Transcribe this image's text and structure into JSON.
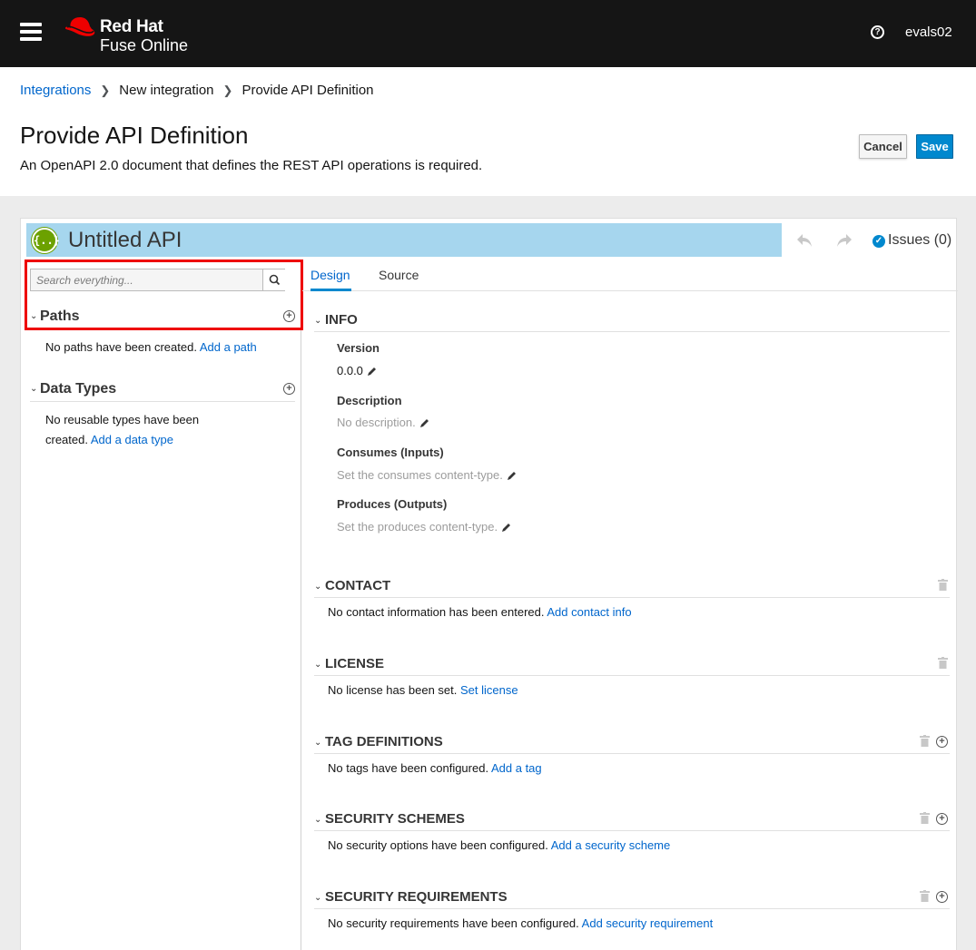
{
  "topbar": {
    "brand_line1": "Red Hat",
    "brand_line2": "Fuse Online",
    "help_glyph": "?",
    "username": "evals02"
  },
  "breadcrumb": {
    "items": [
      "Integrations",
      "New integration",
      "Provide API Definition"
    ]
  },
  "header": {
    "title": "Provide API Definition",
    "subtitle": "An OpenAPI 2.0 document that defines the REST API operations is required.",
    "cancel_label": "Cancel",
    "save_label": "Save"
  },
  "editor": {
    "logo_glyph": "{..}",
    "api_title": "Untitled API",
    "issues_label": "Issues (0)"
  },
  "left": {
    "search_placeholder": "Search everything...",
    "paths": {
      "label": "Paths",
      "empty_text": "No paths have been created.",
      "link": "Add a path"
    },
    "data_types": {
      "label": "Data Types",
      "empty_text_line1": "No reusable types have been",
      "empty_text_line2": "created.",
      "link": "Add a data type"
    }
  },
  "tabs": [
    "Design",
    "Source"
  ],
  "info": {
    "title": "INFO",
    "version_label": "Version",
    "version_value": "0.0.0",
    "description_label": "Description",
    "description_value": "No description.",
    "consumes_label": "Consumes (Inputs)",
    "consumes_value": "Set the consumes content-type.",
    "produces_label": "Produces (Outputs)",
    "produces_value": "Set the produces content-type."
  },
  "sections": {
    "contact": {
      "title": "CONTACT",
      "text": "No contact information has been entered.",
      "link": "Add contact info"
    },
    "license": {
      "title": "LICENSE",
      "text": "No license has been set.",
      "link": "Set license"
    },
    "tags": {
      "title": "TAG DEFINITIONS",
      "text": "No tags have been configured.",
      "link": "Add a tag"
    },
    "security_schemes": {
      "title": "SECURITY SCHEMES",
      "text": "No security options have been configured.",
      "link": "Add a security scheme"
    },
    "security_requirements": {
      "title": "SECURITY REQUIREMENTS",
      "text": "No security requirements have been configured.",
      "link": "Add security requirement"
    }
  },
  "colors": {
    "topbar": "#151515",
    "brand_red": "#ee0000",
    "link": "#0066cc",
    "save_button": "#0088ce",
    "title_bar": "#a6d6ee",
    "api_logo": "#6ca100"
  }
}
